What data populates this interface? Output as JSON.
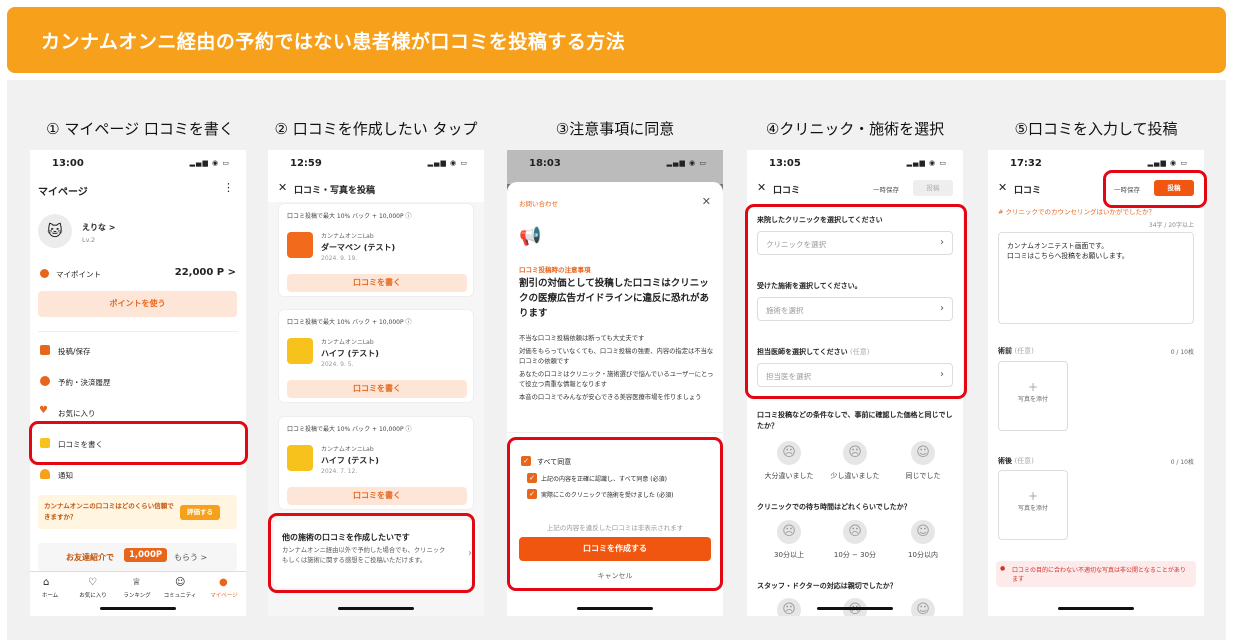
{
  "banner": {
    "title": "カンナムオンニ経由の予約ではない患者様が口コミを投稿する方法"
  },
  "steps": [
    "① マイページ 口コミを書く",
    "② 口コミを作成したい タップ",
    "③注意事項に同意",
    "④クリニック・施術を選択",
    "⑤口コミを入力して投稿"
  ],
  "p1": {
    "time": "13:00",
    "title": "マイページ",
    "more": "⋮",
    "user": "えりな >",
    "level": "Lv.2",
    "points_label": "マイポイント",
    "points_value": "22,000 P >",
    "use_points": "ポイントを使う",
    "menu": [
      "投稿/保存",
      "予約・決済履歴",
      "お気に入り",
      "口コミを書く",
      "通知"
    ],
    "review_q": "カンナムオンニの口コミはどのくらい信頼できますか？",
    "evaluate": "評価する",
    "referral_pre": "お友達紹介で",
    "referral_amt": "1,000P",
    "referral_post": "もらう >",
    "tabs": [
      "ホーム",
      "お気に入り",
      "ランキング",
      "コミュニティ",
      "マイページ"
    ]
  },
  "p2": {
    "time": "12:59",
    "title": "口コミ・写真を投稿",
    "cards": [
      {
        "promo": "口コミ投稿で最大 10% バック + 10,000P ⓘ",
        "clinic": "カンナムオンニLab",
        "name": "ダーマペン (テスト)",
        "date": "2024. 9. 19.",
        "btn": "口コミを書く"
      },
      {
        "promo": "口コミ投稿で最大 10% バック + 10,000P ⓘ",
        "clinic": "カンナムオンニLab",
        "name": "ハイフ (テスト)",
        "date": "2024. 9. 5.",
        "btn": "口コミを書く"
      },
      {
        "promo": "口コミ投稿で最大 10% バック + 10,000P ⓘ",
        "clinic": "カンナムオンニLab",
        "name": "ハイフ (テスト)",
        "date": "2024. 7. 12.",
        "btn": "口コミを書く"
      }
    ],
    "other_title": "他の施術の口コミを作成したいです",
    "other_desc": "カンナムオンニ経由以外で予約した場合でも、クリニックもしくは施術に関する感想をご投稿いただけます。"
  },
  "p3": {
    "time": "18:03",
    "notice": "お問い合わせ",
    "caution_label": "口コミ投稿時の注意事項",
    "heading": "割引の対価として投稿した口コミはクリニックの医療広告ガイドラインに違反に恐れがあります",
    "bullets": [
      "不当な口コミ投稿依頼は断っても大丈夫です",
      "対価をもらっていなくても、口コミ投稿の強要、内容の指定は不当な口コミの依頼です",
      "あなたの口コミはクリニック・施術選びで悩んでいるユーザーにとって役立つ貴重な情報となります",
      "本音の口コミでみんなが安心できる美容医療市場を作りましょう"
    ],
    "agree_all": "すべて同意",
    "agree1": "上記の内容を正確に認識し、すべて同意 (必須)",
    "agree2": "実際にこのクリニックで施術を受けました (必須)",
    "warn": "上記の内容を違反した口コミは非表示されます",
    "create": "口コミを作成する",
    "cancel": "キャンセル"
  },
  "p4": {
    "time": "13:05",
    "title": "口コミ",
    "save": "一時保存",
    "post": "投稿",
    "q1": "来院したクリニックを選択してください",
    "s1": "クリニックを選択",
    "q2": "受けた施術を選択してください。",
    "s2": "施術を選択",
    "q3": "担当医師を選択してください",
    "q3opt": "(任意)",
    "s3": "担当医を選択",
    "q4": "口コミ投稿などの条件なしで、事前に確認した価格と同じでしたか？",
    "f4": [
      "大分違いました",
      "少し違いました",
      "同じでした"
    ],
    "q5": "クリニックでの待ち時間はどれくらいでしたか？",
    "f5": [
      "30分以上",
      "10分 − 30分",
      "10分以内"
    ],
    "q6": "スタッフ・ドクターの対応は親切でしたか？"
  },
  "p5": {
    "time": "17:32",
    "title": "口コミ",
    "save": "一時保存",
    "post": "投稿",
    "hint": "# クリニックでのカウンセリングはいかがでしたか？",
    "count": "34字 / 20字以上",
    "text": "カンナムオンニテスト画面です。\n口コミはこちらへ投稿をお願いします。",
    "before": "術前",
    "before_opt": "(任意)",
    "before_count": "0 / 10枚",
    "after": "術後",
    "after_opt": "(任意)",
    "after_count": "0 / 10枚",
    "add_photo": "写真を添付",
    "warning": "口コミの目的に合わない不適切な写真は非公開となることがあります"
  },
  "colors": {
    "accent": "#e8661c",
    "banner": "#f7a01b",
    "highlight": "#e30613"
  }
}
